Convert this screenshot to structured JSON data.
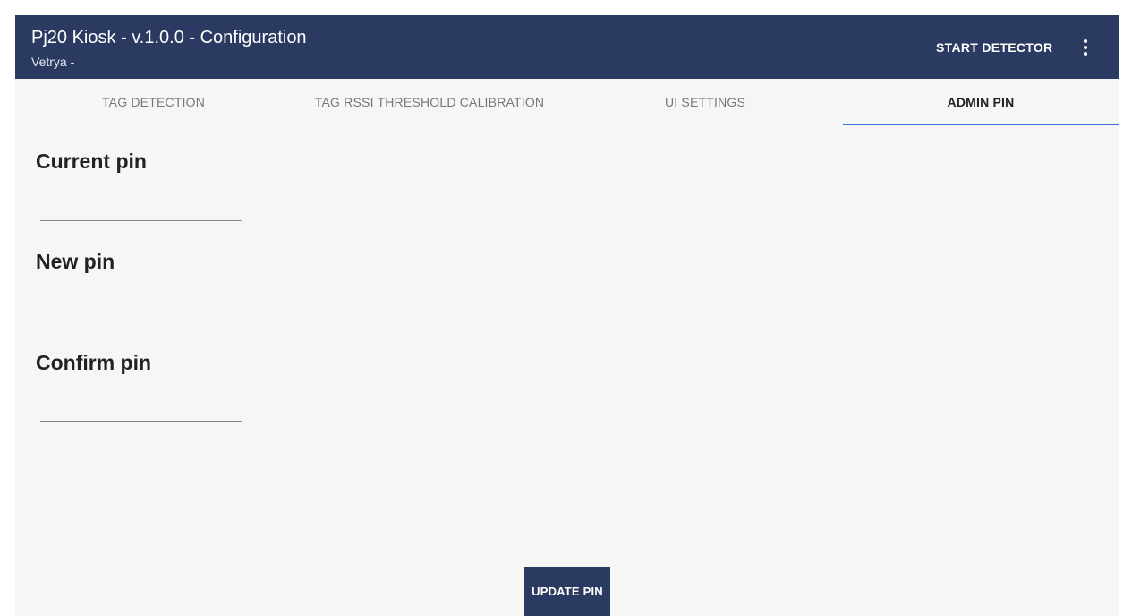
{
  "appbar": {
    "title": "Pj20 Kiosk - v.1.0.0 - Configuration",
    "subtitle": "Vetrya -",
    "start_detector_label": "START DETECTOR",
    "menu_icon": "more-vert-icon"
  },
  "tabs": [
    {
      "label": "TAG DETECTION",
      "active": false
    },
    {
      "label": "TAG RSSI THRESHOLD CALIBRATION",
      "active": false
    },
    {
      "label": "UI SETTINGS",
      "active": false
    },
    {
      "label": "ADMIN PIN",
      "active": true
    }
  ],
  "form": {
    "current_pin": {
      "label": "Current pin",
      "value": ""
    },
    "new_pin": {
      "label": "New pin",
      "value": ""
    },
    "confirm_pin": {
      "label": "Confirm pin",
      "value": ""
    },
    "update_button_label": "UPDATE PIN"
  },
  "colors": {
    "appbar": "#2a3a60",
    "background": "#f6f6f6",
    "tab_indicator": "#3d6fd1"
  }
}
